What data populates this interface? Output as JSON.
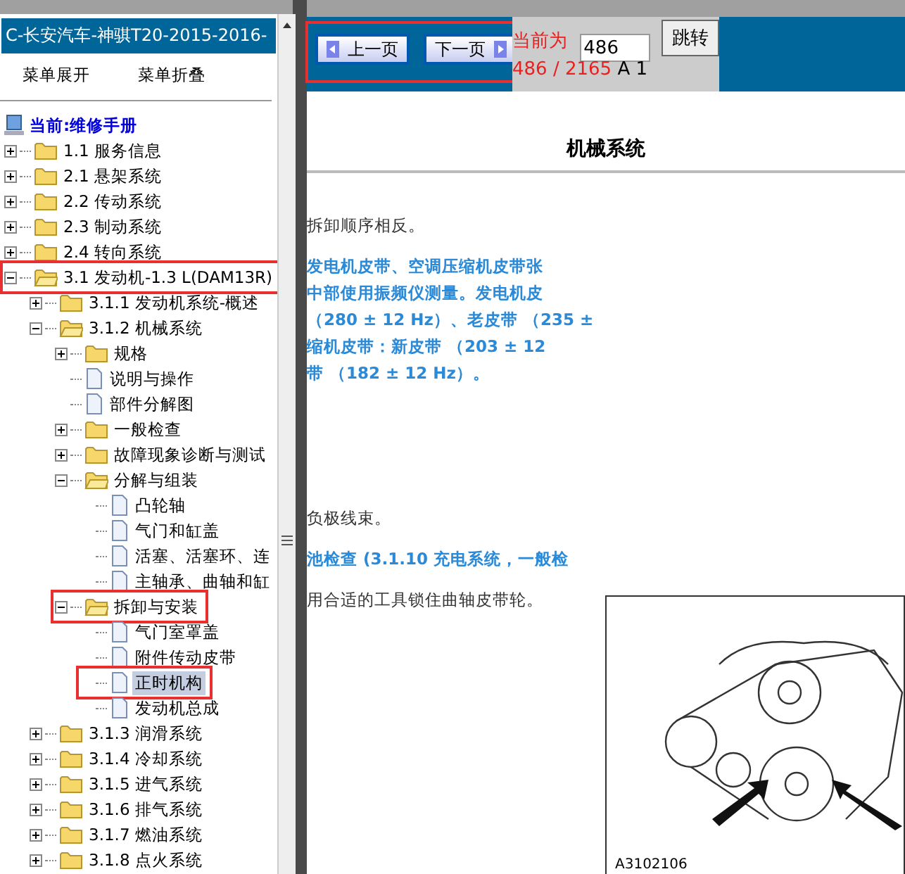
{
  "sidebar": {
    "title": "C-长安汽车-神骐T20-2015-2016-",
    "menu_buttons": [
      "菜单展开",
      "菜单折叠"
    ],
    "tree": {
      "label": "当前:维修手册",
      "children": [
        {
          "label": "1.1 服务信息",
          "kind": "folder",
          "expanded": false,
          "selected": false,
          "highlighted": false
        },
        {
          "label": "2.1 悬架系统",
          "kind": "folder",
          "expanded": false,
          "selected": false,
          "highlighted": false
        },
        {
          "label": "2.2 传动系统",
          "kind": "folder",
          "expanded": false,
          "selected": false,
          "highlighted": false
        },
        {
          "label": "2.3 制动系统",
          "kind": "folder",
          "expanded": false,
          "selected": false,
          "highlighted": false
        },
        {
          "label": "2.4 转向系统",
          "kind": "folder",
          "expanded": false,
          "selected": false,
          "highlighted": false
        },
        {
          "label": "3.1 发动机-1.3 L(DAM13R)",
          "kind": "folder",
          "expanded": true,
          "selected": false,
          "highlighted": true,
          "children": [
            {
              "label": "3.1.1 发动机系统-概述",
              "kind": "folder",
              "expanded": false,
              "selected": false,
              "highlighted": false
            },
            {
              "label": "3.1.2 机械系统",
              "kind": "folder",
              "expanded": true,
              "selected": false,
              "highlighted": false,
              "children": [
                {
                  "label": "规格",
                  "kind": "folder",
                  "expanded": false,
                  "selected": false,
                  "highlighted": false
                },
                {
                  "label": "说明与操作",
                  "kind": "doc",
                  "selected": false,
                  "highlighted": false
                },
                {
                  "label": "部件分解图",
                  "kind": "doc",
                  "selected": false,
                  "highlighted": false
                },
                {
                  "label": "一般检查",
                  "kind": "folder",
                  "expanded": false,
                  "selected": false,
                  "highlighted": false
                },
                {
                  "label": "故障现象诊断与测试",
                  "kind": "folder",
                  "expanded": false,
                  "selected": false,
                  "highlighted": false
                },
                {
                  "label": "分解与组装",
                  "kind": "folder",
                  "expanded": true,
                  "selected": false,
                  "highlighted": false,
                  "children": [
                    {
                      "label": "凸轮轴",
                      "kind": "doc",
                      "selected": false,
                      "highlighted": false
                    },
                    {
                      "label": "气门和缸盖",
                      "kind": "doc",
                      "selected": false,
                      "highlighted": false
                    },
                    {
                      "label": "活塞、活塞环、连",
                      "kind": "doc",
                      "selected": false,
                      "highlighted": false
                    },
                    {
                      "label": "主轴承、曲轴和缸",
                      "kind": "doc",
                      "selected": false,
                      "highlighted": false
                    }
                  ]
                },
                {
                  "label": "拆卸与安装",
                  "kind": "folder",
                  "expanded": true,
                  "selected": false,
                  "highlighted": true,
                  "children": [
                    {
                      "label": "气门室罩盖",
                      "kind": "doc",
                      "selected": false,
                      "highlighted": false
                    },
                    {
                      "label": "附件传动皮带",
                      "kind": "doc",
                      "selected": false,
                      "highlighted": false
                    },
                    {
                      "label": "正时机构",
                      "kind": "doc",
                      "selected": true,
                      "highlighted": true
                    },
                    {
                      "label": "发动机总成",
                      "kind": "doc",
                      "selected": false,
                      "highlighted": false
                    }
                  ]
                }
              ]
            },
            {
              "label": "3.1.3 润滑系统",
              "kind": "folder",
              "expanded": false,
              "selected": false,
              "highlighted": false
            },
            {
              "label": "3.1.4 冷却系统",
              "kind": "folder",
              "expanded": false,
              "selected": false,
              "highlighted": false
            },
            {
              "label": "3.1.5 进气系统",
              "kind": "folder",
              "expanded": false,
              "selected": false,
              "highlighted": false
            },
            {
              "label": "3.1.6 排气系统",
              "kind": "folder",
              "expanded": false,
              "selected": false,
              "highlighted": false
            },
            {
              "label": "3.1.7 燃油系统",
              "kind": "folder",
              "expanded": false,
              "selected": false,
              "highlighted": false
            },
            {
              "label": "3.1.8 点火系统",
              "kind": "folder",
              "expanded": false,
              "selected": false,
              "highlighted": false
            }
          ]
        }
      ]
    }
  },
  "toolbar": {
    "prev_button": "上一页",
    "next_button": "下一页",
    "nav_highlighted": true,
    "current_label": "当前为",
    "page_input": "486",
    "jump_button": "跳转",
    "page_count": "486 / 2165",
    "page_suffix": "A 1"
  },
  "document": {
    "title": "机械系统",
    "paragraphs": [
      {
        "kind": "plain",
        "lines": [
          "拆卸顺序相反。"
        ]
      },
      {
        "kind": "note",
        "lines": [
          "发电机皮带、空调压缩机皮带张",
          "中部使用振频仪测量。发电机皮",
          "（280 ± 12 Hz）、老皮带 （235 ±",
          "缩机皮带：新皮带 （203 ± 12",
          "带 （182 ± 12 Hz）。"
        ]
      },
      {
        "kind": "plain",
        "lines": [
          "负极线束。"
        ]
      },
      {
        "kind": "note",
        "lines": [
          "池检查 (3.1.10 充电系统，一般检"
        ]
      },
      {
        "kind": "plain",
        "lines": [
          "用合适的工具锁住曲轴皮带轮。"
        ]
      }
    ],
    "figure": {
      "caption": "A3102106"
    }
  }
}
